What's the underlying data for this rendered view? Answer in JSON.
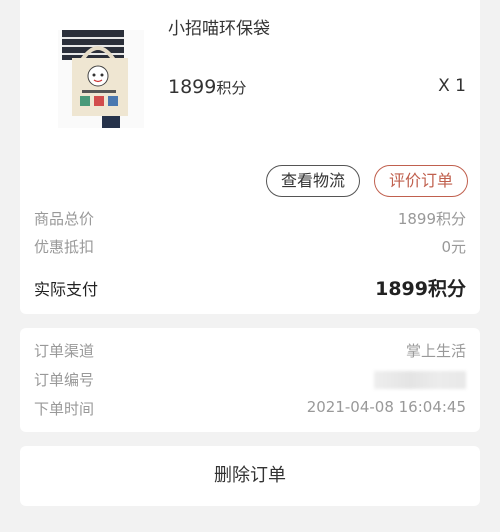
{
  "product": {
    "name": "小招喵环保袋",
    "points_value": "1899",
    "points_unit": "积分",
    "quantity": "X 1",
    "image_icon": "tote-bag-image"
  },
  "actions": {
    "logistics_label": "查看物流",
    "review_label": "评价订单",
    "delete_label": "删除订单"
  },
  "summary": {
    "total_label": "商品总价",
    "total_value": "1899积分",
    "discount_label": "优惠抵扣",
    "discount_value": "0元",
    "paid_label": "实际支付",
    "paid_value": "1899积分"
  },
  "order_info": {
    "channel_label": "订单渠道",
    "channel_value": "掌上生活",
    "number_label": "订单编号",
    "time_label": "下单时间",
    "time_value": "2021-04-08 16:04:45"
  },
  "colors": {
    "accent": "#c0604e",
    "background": "#f2f2f2"
  }
}
